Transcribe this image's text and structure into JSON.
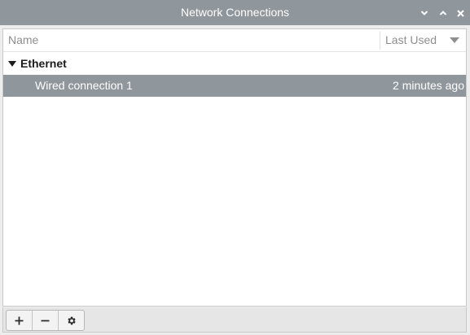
{
  "window": {
    "title": "Network Connections",
    "controls": [
      "minimize",
      "maximize",
      "close"
    ]
  },
  "columns": {
    "name": "Name",
    "last_used": "Last Used"
  },
  "groups": [
    {
      "label": "Ethernet",
      "expanded": true,
      "connections": [
        {
          "name": "Wired connection 1",
          "last_used": "2 minutes ago",
          "selected": true
        }
      ]
    }
  ],
  "toolbar": {
    "add_icon": "plus-icon",
    "remove_icon": "minus-icon",
    "settings_icon": "gear-icon"
  },
  "colors": {
    "titlebar": "#8f969c",
    "selection": "#8f969c",
    "text_on_dark": "#ffffff"
  }
}
